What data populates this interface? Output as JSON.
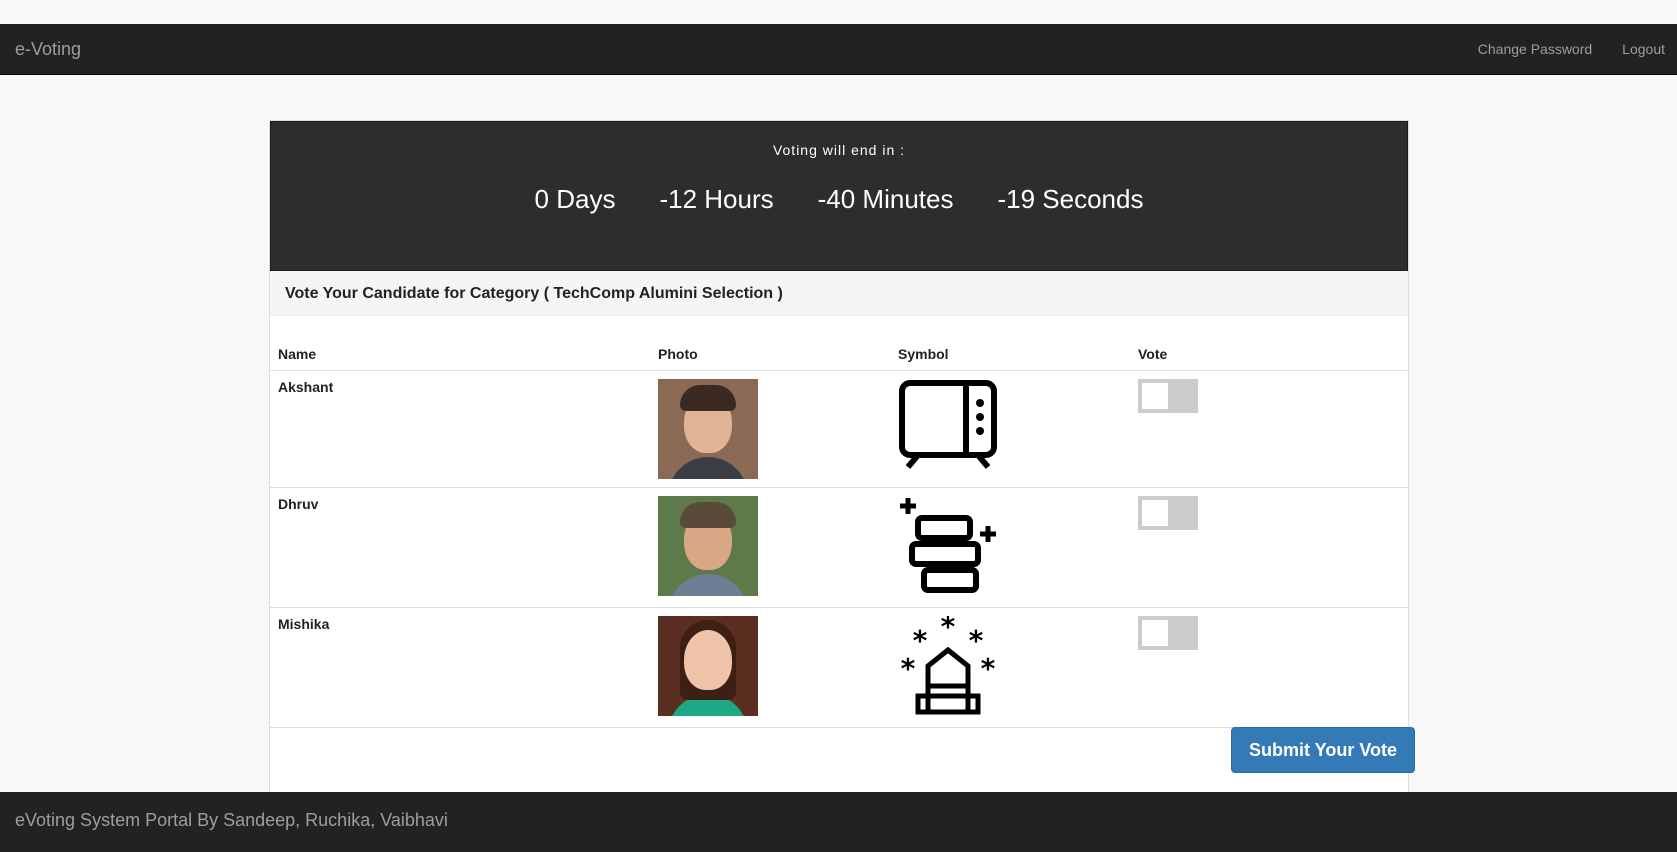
{
  "navbar": {
    "brand": "e-Voting",
    "links": [
      "Change Password",
      "Logout"
    ]
  },
  "timer": {
    "title": "Voting will end in :",
    "days": "0 Days",
    "hours": "-12 Hours",
    "minutes": "-40 Minutes",
    "seconds": "-19 Seconds"
  },
  "heading": "Vote Your Candidate for Category ( TechComp Alumini Selection )",
  "table": {
    "columns": [
      "Name",
      "Photo",
      "Symbol",
      "Vote"
    ],
    "rows": [
      {
        "name": "Akshant",
        "symbol": "tv-icon",
        "vote_selected": false
      },
      {
        "name": "Dhruv",
        "symbol": "stacked-blocks-icon",
        "vote_selected": false
      },
      {
        "name": "Mishika",
        "symbol": "tower-stars-icon",
        "vote_selected": false
      }
    ]
  },
  "submit_label": "Submit Your Vote",
  "footer": "eVoting System Portal By Sandeep, Ruchika, Vaibhavi",
  "colors": {
    "navbar": "#222222",
    "timer": "#2d2d2d",
    "primary": "#337ab7",
    "toggle_off": "#cccccc"
  }
}
